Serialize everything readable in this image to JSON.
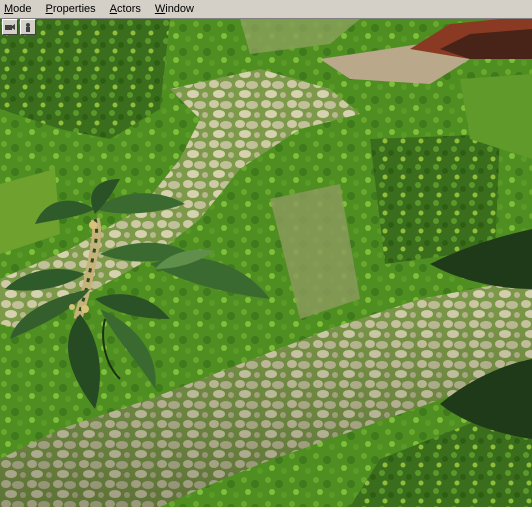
{
  "menubar": {
    "items": [
      {
        "label": "Mode",
        "accel": "M",
        "rest": "ode"
      },
      {
        "label": "Properties",
        "accel": "P",
        "rest": "roperties"
      },
      {
        "label": "Actors",
        "accel": "A",
        "rest": "ctors"
      },
      {
        "label": "Window",
        "accel": "W",
        "rest": "indow"
      }
    ]
  },
  "toolbar": {
    "buttons": [
      {
        "icon": "camera-view-icon"
      },
      {
        "icon": "actor-select-icon"
      }
    ]
  },
  "colors": {
    "grass_dark": "#2e5e12",
    "grass": "#4f8f22",
    "grass_light": "#7fbf3a",
    "path": "#c9c6a0",
    "path_dark": "#9fa27a",
    "leaf": "#2f5a2a",
    "leaf_light": "#5f8f4a",
    "brick": "#8a3a22"
  }
}
